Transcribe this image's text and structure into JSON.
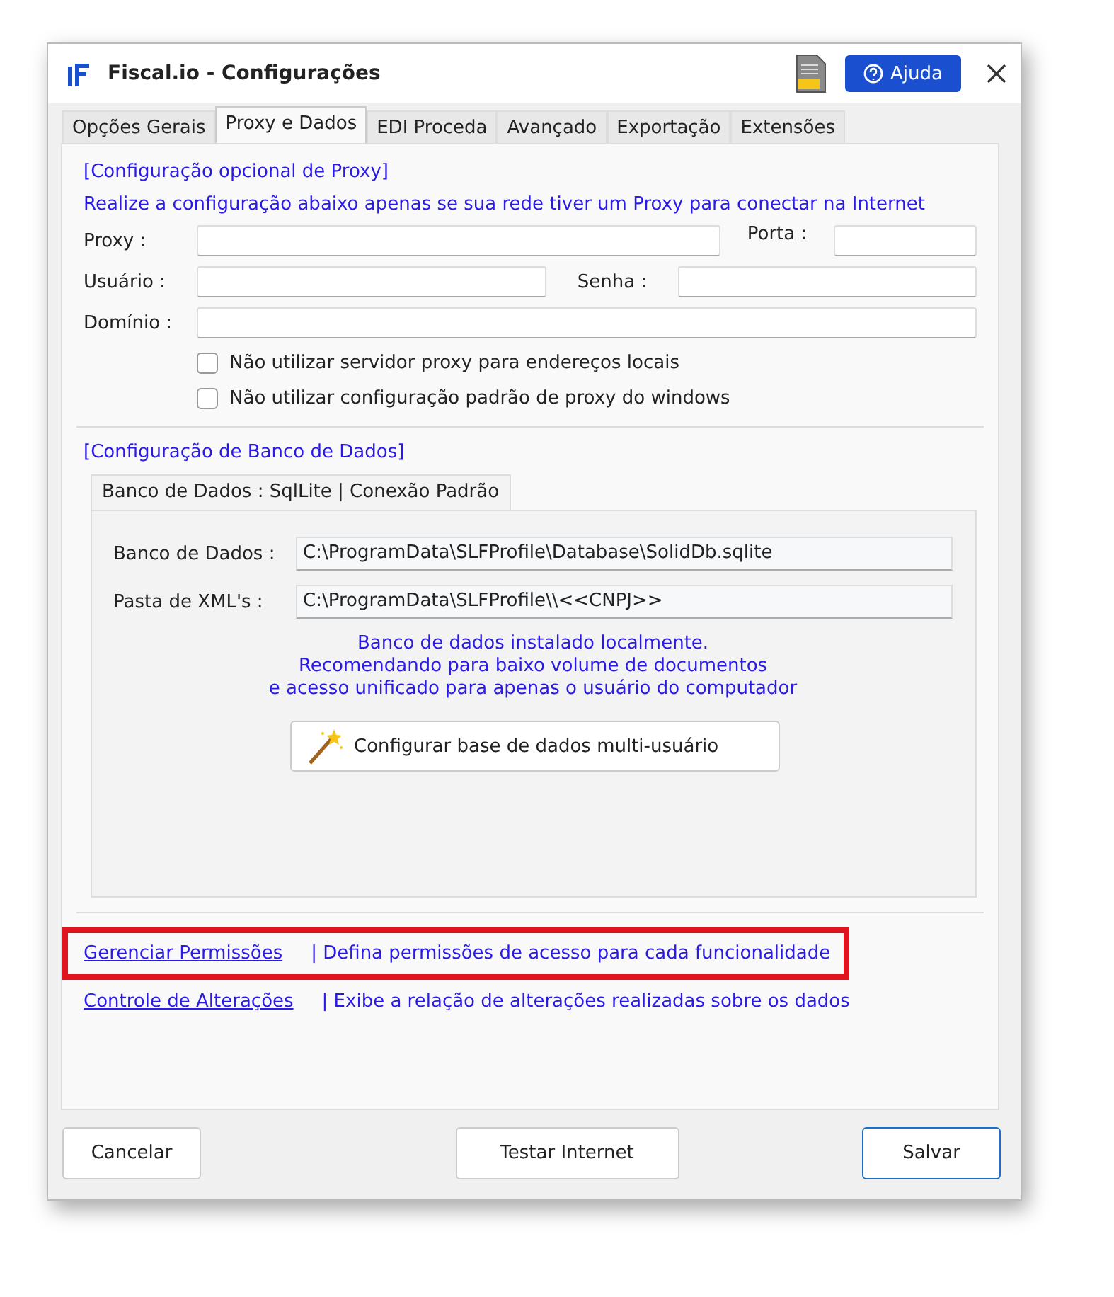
{
  "window": {
    "title": "Fiscal.io - Configurações",
    "help_button": "Ajuda"
  },
  "tabs": [
    {
      "label": "Opções Gerais",
      "selected": false
    },
    {
      "label": "Proxy e Dados",
      "selected": true
    },
    {
      "label": "EDI Proceda",
      "selected": false
    },
    {
      "label": "Avançado",
      "selected": false
    },
    {
      "label": "Exportação",
      "selected": false
    },
    {
      "label": "Extensões",
      "selected": false
    }
  ],
  "proxy": {
    "heading": "[Configuração opcional de Proxy]",
    "hint": "Realize a configuração abaixo apenas se sua rede tiver um Proxy para conectar na Internet",
    "proxy_label": "Proxy :",
    "port_label": "Porta :",
    "user_label": "Usuário :",
    "password_label": "Senha :",
    "domain_label": "Domínio :",
    "checkboxes": [
      {
        "label": "Não utilizar servidor proxy para endereços locais",
        "checked": false
      },
      {
        "label": "Não utilizar configuração padrão de proxy do windows",
        "checked": false
      }
    ]
  },
  "database": {
    "heading": "[Configuração de Banco de Dados]",
    "tabs": [
      {
        "label": "Banco de Dados : SqlLite | Conexão Padrão",
        "selected": true
      }
    ],
    "fields": [
      {
        "label": "Banco de Dados :",
        "value": "C:\\ProgramData\\SLFProfile\\Database\\SolidDb.sqlite"
      },
      {
        "label": "Pasta de XML's :",
        "value": "C:\\ProgramData\\SLFProfile\\\\<<CNPJ>>"
      }
    ],
    "info": [
      "Banco de dados instalado localmente.",
      "Recomendando para baixo volume de documentos",
      "e acesso unificado para apenas o usuário do computador"
    ],
    "wizard_button": "Configurar base de dados multi-usuário"
  },
  "links": [
    {
      "link": "Gerenciar Permissões",
      "description": "| Defina permissões de acesso para cada funcionalidade",
      "highlighted": true
    },
    {
      "link": "Controle de Alterações",
      "description": "| Exibe a relação de alterações realizadas sobre os dados",
      "highlighted": false
    }
  ],
  "buttons": [
    {
      "label": "Cancelar",
      "default": false
    },
    {
      "label": "Testar Internet",
      "default": false
    },
    {
      "label": "Salvar",
      "default": true
    }
  ]
}
